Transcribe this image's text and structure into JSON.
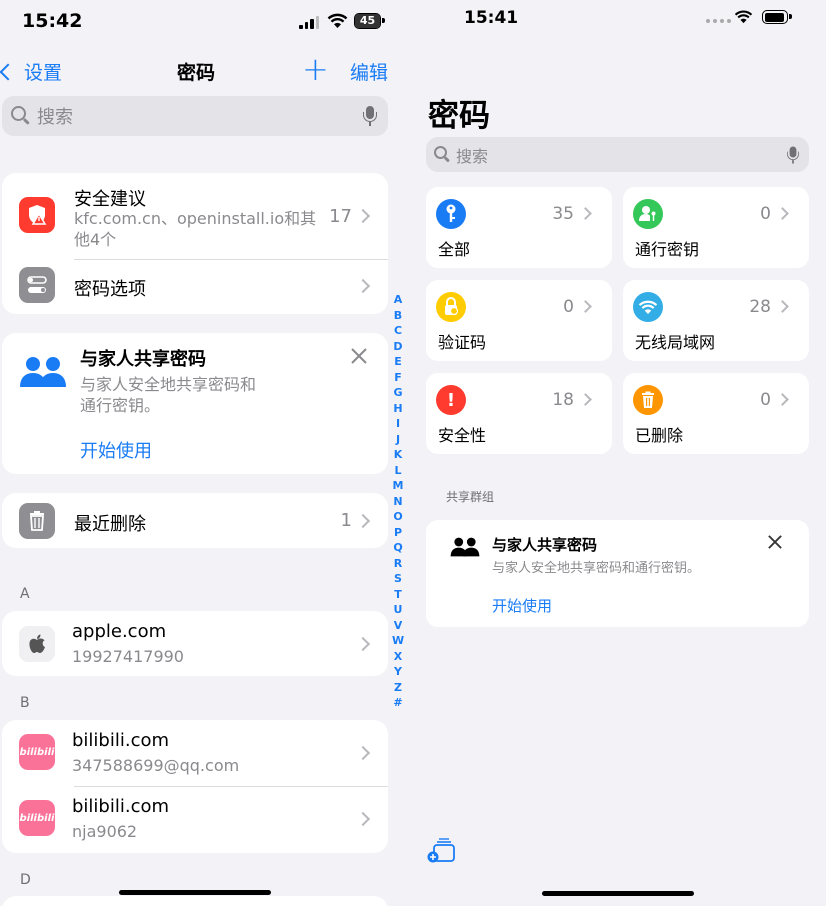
{
  "left": {
    "status_time": "15:42",
    "battery_level": "45",
    "nav": {
      "back_label": "设置",
      "title": "密码",
      "add_label": "+",
      "edit_label": "编辑"
    },
    "search_placeholder": "搜索",
    "security": {
      "title": "安全建议",
      "subtitle_line1": "kfc.com.cn、openinstall.io和其",
      "subtitle_line2": "他4个",
      "count": "17"
    },
    "password_options": {
      "title": "密码选项"
    },
    "family": {
      "title": "与家人共享密码",
      "desc_line1": "与家人安全地共享密码和",
      "desc_line2": "通行密钥。",
      "action": "开始使用"
    },
    "recently_deleted": {
      "title": "最近删除",
      "count": "1"
    },
    "index_letters": [
      "A",
      "B",
      "C",
      "D",
      "E",
      "F",
      "G",
      "H",
      "I",
      "J",
      "K",
      "L",
      "M",
      "N",
      "O",
      "P",
      "Q",
      "R",
      "S",
      "T",
      "U",
      "V",
      "W",
      "X",
      "Y",
      "Z",
      "#"
    ],
    "section_a": "A",
    "section_b": "B",
    "section_d": "D",
    "entries": [
      {
        "site": "apple.com",
        "account": "19927417990"
      },
      {
        "site": "bilibili.com",
        "account": "347588699@qq.com"
      },
      {
        "site": "bilibili.com",
        "account": "nja9062"
      }
    ],
    "bili_icon_text": "bilibili"
  },
  "right": {
    "status_time": "15:41",
    "title": "密码",
    "search_placeholder": "搜索",
    "tiles": [
      {
        "label": "全部",
        "count": "35",
        "color": "#1a7cf5"
      },
      {
        "label": "通行密钥",
        "count": "0",
        "color": "#34c759"
      },
      {
        "label": "验证码",
        "count": "0",
        "color": "#ffcc00"
      },
      {
        "label": "无线局域网",
        "count": "28",
        "color": "#32ade6"
      },
      {
        "label": "安全性",
        "count": "18",
        "color": "#ff3b30"
      },
      {
        "label": "已删除",
        "count": "0",
        "color": "#ff9500"
      }
    ],
    "group_label": "共享群组",
    "family": {
      "title": "与家人共享密码",
      "desc": "与家人安全地共享密码和通行密钥。",
      "action": "开始使用"
    }
  }
}
